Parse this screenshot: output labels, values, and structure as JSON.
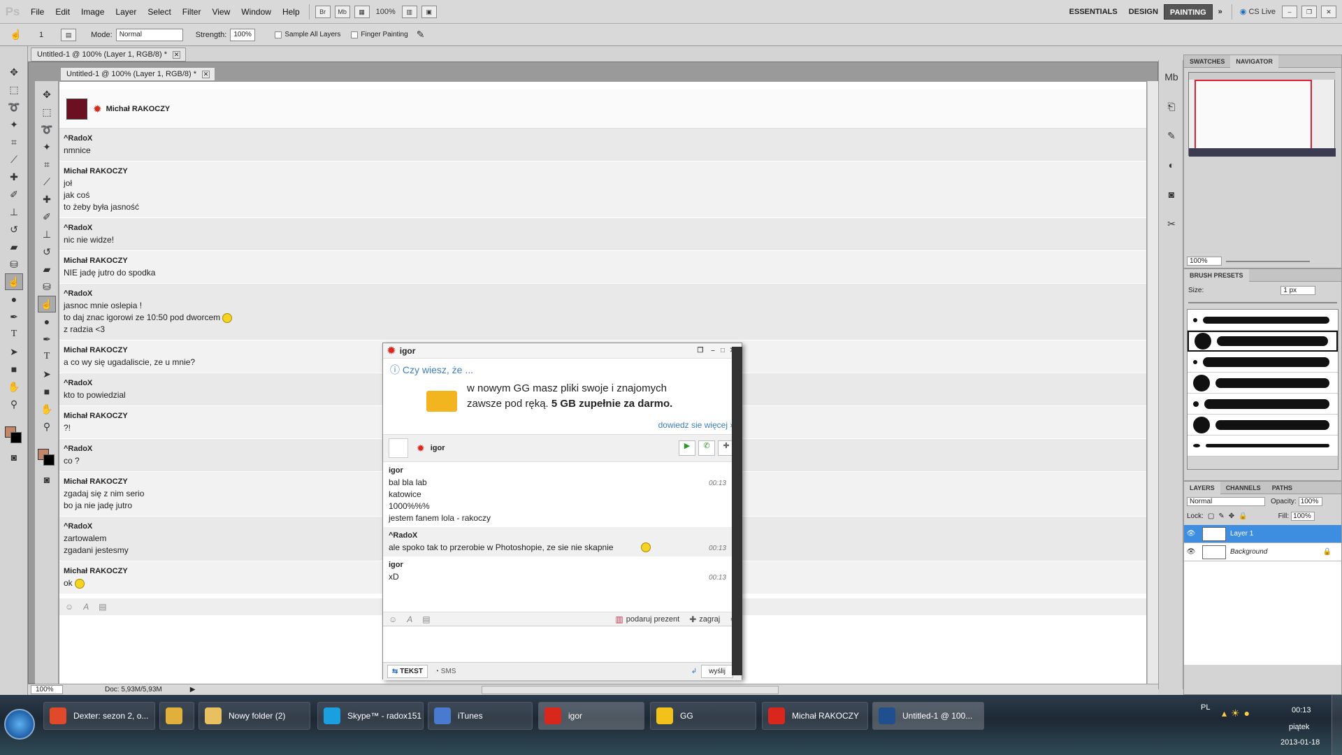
{
  "menubar": {
    "logo": "Ps",
    "menus": [
      "File",
      "Edit",
      "Image",
      "Layer",
      "Select",
      "Filter",
      "View",
      "Window",
      "Help"
    ],
    "zoom": "100%",
    "workspaces": [
      "ESSENTIALS",
      "DESIGN",
      "PAINTING"
    ],
    "active_workspace": "PAINTING",
    "cs_live": "CS Live"
  },
  "options": {
    "brush_size": "1",
    "mode_label": "Mode:",
    "mode_value": "Normal",
    "strength_label": "Strength:",
    "strength_value": "100%",
    "sample_all_layers": "Sample All Layers",
    "finger_painting": "Finger Painting"
  },
  "doc_tab_outer": "Untitled-1 @ 100% (Layer 1, RGB/8) *",
  "doc_tab_inner": "Untitled-1 @ 100% (Layer 1, RGB/8) *",
  "chat": {
    "contact": "Michał RAKOCZY",
    "messages": [
      {
        "sender": "^RadoX",
        "lines": [
          "nmnice"
        ]
      },
      {
        "sender": "Michał RAKOCZY",
        "lines": [
          "joł",
          "jak coś",
          "to żeby była jasność"
        ]
      },
      {
        "sender": "^RadoX",
        "lines": [
          "nic nie widze!"
        ]
      },
      {
        "sender": "Michał RAKOCZY",
        "lines": [
          "NIE jadę jutro do spodka"
        ]
      },
      {
        "sender": "^RadoX",
        "lines": [
          "jasnoc mnie oslepia !",
          "to daj znac igorowi ze 10:50 pod dworcem",
          "z radzia <3"
        ]
      },
      {
        "sender": "Michał RAKOCZY",
        "lines": [
          "a co wy się ugadaliscie, ze u mnie?"
        ]
      },
      {
        "sender": "^RadoX",
        "lines": [
          "kto to powiedzial"
        ]
      },
      {
        "sender": "Michał RAKOCZY",
        "lines": [
          "?!"
        ]
      },
      {
        "sender": "^RadoX",
        "lines": [
          "co ?"
        ]
      },
      {
        "sender": "Michał RAKOCZY",
        "lines": [
          "zgadaj się z nim serio",
          "bo ja nie jadę jutro"
        ]
      },
      {
        "sender": "^RadoX",
        "lines": [
          "zartowalem",
          "zgadani jestesmy"
        ]
      },
      {
        "sender": "Michał RAKOCZY",
        "lines": [
          "ok"
        ]
      }
    ]
  },
  "status": {
    "zoom": "100%",
    "doc": "Doc: 5,93M/5,93M"
  },
  "panels": {
    "swatches": "SWATCHES",
    "navigator": "NAVIGATOR",
    "nav_zoom": "100%",
    "brush_presets": "BRUSH PRESETS",
    "size_label": "Size:",
    "size_value": "1 px",
    "layers": "LAYERS",
    "channels": "CHANNELS",
    "paths": "PATHS",
    "blend_mode": "Normal",
    "opacity_label": "Opacity:",
    "opacity_value": "100%",
    "lock_label": "Lock:",
    "fill_label": "Fill:",
    "fill_value": "100%",
    "layer_list": [
      {
        "name": "Layer 1",
        "selected": true
      },
      {
        "name": "Background",
        "selected": false
      }
    ]
  },
  "gg": {
    "title": "igor",
    "tip_title": "Czy wiesz, że ...",
    "tip_line1": "w nowym GG masz pliki swoje i znajomych",
    "tip_line2_prefix": "zawsze pod ręką.",
    "tip_line2_bold": "5 GB zupełnie za darmo.",
    "tip_link": "dowiedz sie więcej »",
    "contact": "igor",
    "messages": [
      {
        "sender": "igor",
        "lines": [
          "bal bla lab",
          "katowice",
          "1000%%%",
          "jestem fanem lola - rakoczy"
        ],
        "time": "00:13"
      },
      {
        "sender": "^RadoX",
        "lines": [
          "ale spoko tak to przerobie w Photoshopie, ze sie nie skapnie"
        ],
        "time": "00:13"
      },
      {
        "sender": "igor",
        "lines": [
          "xD"
        ],
        "time": "00:13"
      }
    ],
    "gift": "podaruj prezent",
    "play": "zagraj",
    "tab_text": "TEKST",
    "tab_sms": "SMS",
    "send": "wyślij"
  },
  "taskbar": {
    "items": [
      {
        "label": "Dexter: sezon 2, o...",
        "color": "#e04a2b"
      },
      {
        "label": "",
        "color": "#e0b03a"
      },
      {
        "label": "Nowy folder (2)",
        "color": "#e8c060"
      },
      {
        "label": "Skype™ - radox151",
        "color": "#1aa0e0"
      },
      {
        "label": "iTunes",
        "color": "#4a7ad0"
      },
      {
        "label": "igor",
        "color": "#d9271e"
      },
      {
        "label": "GG",
        "color": "#f2c21b"
      },
      {
        "label": "Michał RAKOCZY",
        "color": "#d9271e"
      },
      {
        "label": "Untitled-1 @ 100...",
        "color": "#1f4f8f"
      }
    ],
    "lang": "PL",
    "time": "00:13",
    "day": "piątek",
    "date": "2013-01-18"
  }
}
